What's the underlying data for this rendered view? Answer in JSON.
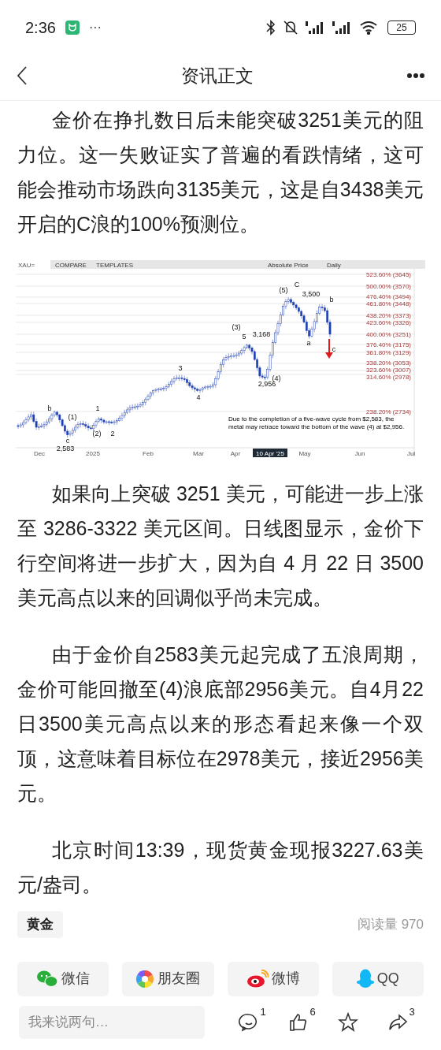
{
  "status_bar": {
    "time": "2:36",
    "more": "···",
    "battery": "25"
  },
  "header": {
    "title": "资讯正文"
  },
  "paragraphs_before": [
    "金价在挣扎数日后未能突破3251美元的阻力位。这一失败证实了普遍的看跌情绪，这可能会推动市场跌向3135美元，这是自3438美元开启的C浪的100%预测位。"
  ],
  "chart": {
    "toolbar": {
      "symbol": "XAU=",
      "compare": "COMPARE",
      "templates": "TEMPLATES",
      "price_mode": "Absolute Price",
      "interval": "Daily"
    },
    "fib_levels": [
      "523.60% (3645)",
      "500.00% (3570)",
      "476.40% (3494)",
      "461.80% (3448)",
      "438.20% (3373)",
      "423.60% (3326)",
      "400.00% (3251)",
      "376.40% (3175)",
      "361.80% (3129)",
      "338.20% (3053)",
      "323.60% (3007)",
      "314.60% (2978)",
      "238.20% (2734)"
    ],
    "wave_labels": [
      "b",
      "(1)",
      "c",
      "2,583",
      "1",
      "(2)",
      "2",
      "3",
      "4",
      "(3)",
      "5",
      "3,168",
      "(4)",
      "2,956",
      "(5)",
      "C",
      "3,500",
      "b",
      "a",
      "c"
    ],
    "annotation": "Due to the completion of a five-wave cycle from $2,583, the metal may retrace toward the bottom of the wave (4) at $2,956.",
    "x_labels": [
      {
        "text": "Dec",
        "selected": false
      },
      {
        "text": "2025",
        "selected": false
      },
      {
        "text": "Feb",
        "selected": false
      },
      {
        "text": "Mar",
        "selected": false
      },
      {
        "text": "Apr",
        "selected": false
      },
      {
        "text": "10 Apr '25",
        "selected": true
      },
      {
        "text": "May",
        "selected": false
      },
      {
        "text": "Jun",
        "selected": false
      },
      {
        "text": "Jul",
        "selected": false
      }
    ]
  },
  "paragraphs_after": [
    "如果向上突破 3251 美元，可能进一步上涨至 3286-3322 美元区间。日线图显示，金价下行空间将进一步扩大，因为自 4 月 22 日 3500 美元高点以来的回调似乎尚未完成。",
    "由于金价自2583美元起完成了五浪周期，金价可能回撤至(4)浪底部2956美元。自4月22日3500美元高点以来的形态看起来像一个双顶，这意味着目标位在2978美元，接近2956美元。",
    "北京时间13:39，现货黄金现报3227.63美元/盎司。"
  ],
  "tag": "黄金",
  "read_count": "阅读量 970",
  "share": [
    {
      "kind": "wechat",
      "label": "微信"
    },
    {
      "kind": "moments",
      "label": "朋友圈"
    },
    {
      "kind": "weibo",
      "label": "微博"
    },
    {
      "kind": "qq",
      "label": "QQ"
    }
  ],
  "comment_box": {
    "placeholder": "我来说两句…"
  },
  "actions": [
    {
      "kind": "comment",
      "count": "1"
    },
    {
      "kind": "like",
      "count": "6"
    },
    {
      "kind": "favorite"
    },
    {
      "kind": "share",
      "count": "3"
    }
  ]
}
